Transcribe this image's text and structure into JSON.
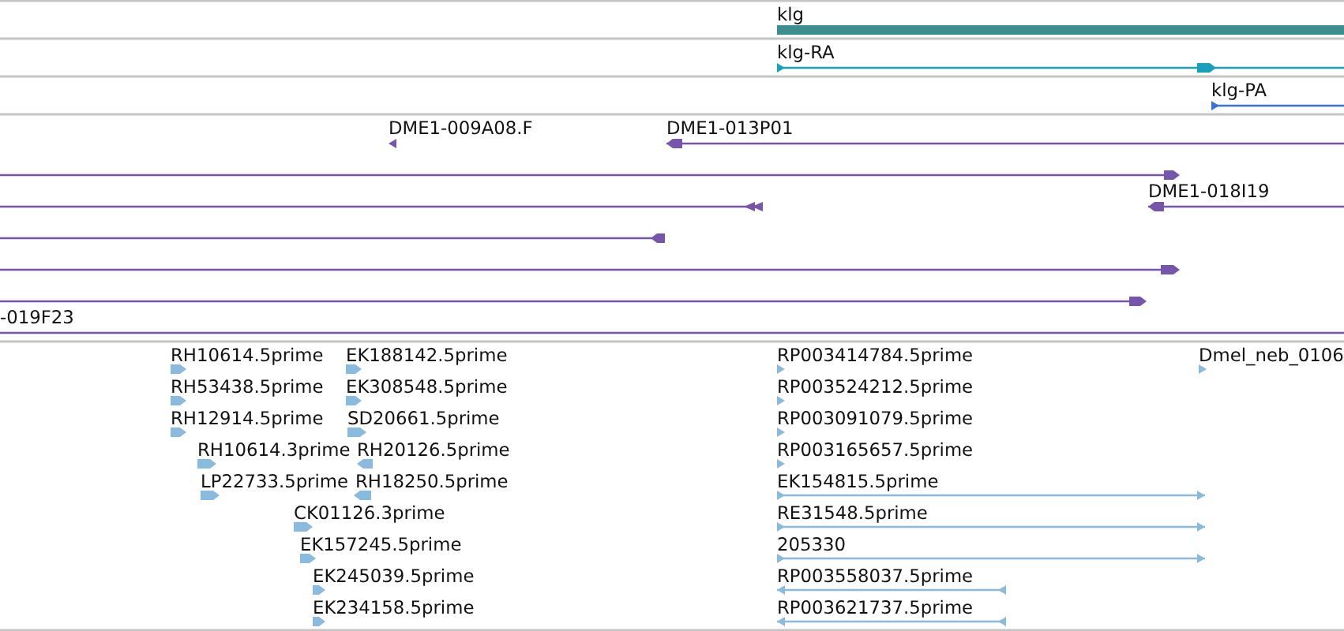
{
  "tracks": [
    {
      "kind": "gene",
      "features": [
        {
          "label": "klg"
        }
      ]
    },
    {
      "kind": "transcript",
      "features": [
        {
          "label": "klg-RA",
          "reverse": false
        }
      ]
    },
    {
      "kind": "transcript",
      "features": [
        {
          "label": "klg-PA",
          "reverse": false
        }
      ]
    },
    {
      "kind": "clone",
      "features": [
        {
          "label": "DME1-009A08.F",
          "reverse": true
        },
        {
          "label": "DME1-013P01",
          "reverse": true
        },
        {
          "reverse": false
        },
        {
          "reverse": true
        },
        {
          "label": "DME1-018I19",
          "reverse": true
        },
        {
          "reverse": true
        },
        {
          "reverse": false
        },
        {
          "reverse": false
        },
        {
          "label": "-019F23"
        }
      ]
    },
    {
      "kind": "est",
      "features": [
        {
          "label": "RH10614.5prime",
          "reverse": false
        },
        {
          "label": "EK188142.5prime",
          "reverse": false
        },
        {
          "label": "RP003414784.5prime",
          "reverse": false
        },
        {
          "label": "Dmel_neb_0106",
          "reverse": false
        },
        {
          "label": "RH53438.5prime",
          "reverse": false
        },
        {
          "label": "EK308548.5prime",
          "reverse": false
        },
        {
          "label": "RP003524212.5prime",
          "reverse": false
        },
        {
          "label": "RH12914.5prime",
          "reverse": false
        },
        {
          "label": "SD20661.5prime",
          "reverse": false
        },
        {
          "label": "RP003091079.5prime",
          "reverse": false
        },
        {
          "label": "RH10614.3prime",
          "reverse": false
        },
        {
          "label": "RH20126.5prime",
          "reverse": true
        },
        {
          "label": "RP003165657.5prime",
          "reverse": false
        },
        {
          "label": "LP22733.5prime",
          "reverse": false
        },
        {
          "label": "RH18250.5prime",
          "reverse": true
        },
        {
          "label": "EK154815.5prime",
          "reverse": false
        },
        {
          "label": "CK01126.3prime",
          "reverse": false
        },
        {
          "label": "RE31548.5prime",
          "reverse": false
        },
        {
          "label": "EK157245.5prime",
          "reverse": false
        },
        {
          "label": "205330",
          "reverse": false
        },
        {
          "label": "EK245039.5prime",
          "reverse": false
        },
        {
          "label": "RP003558037.5prime",
          "reverse": true
        },
        {
          "label": "EK234158.5prime",
          "reverse": false
        },
        {
          "label": "RP003621737.5prime",
          "reverse": true
        }
      ]
    }
  ]
}
